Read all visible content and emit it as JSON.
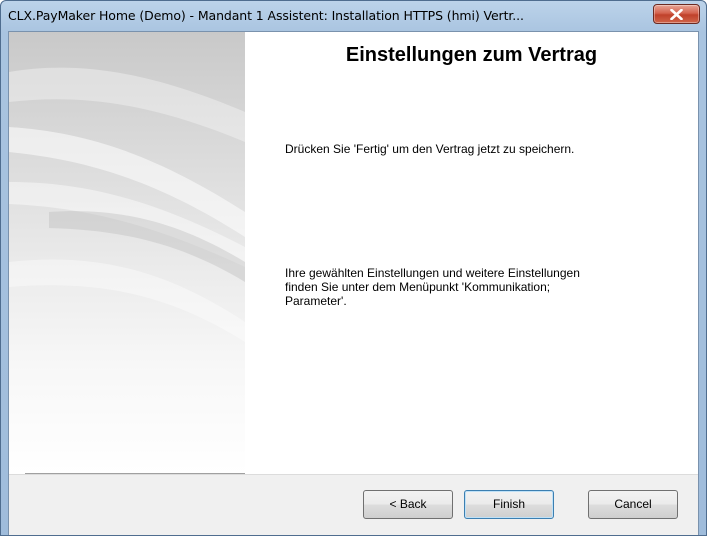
{
  "window": {
    "title": "CLX.PayMaker Home (Demo) - Mandant 1 Assistent: Installation HTTPS (hmi) Vertr..."
  },
  "wizard": {
    "heading": "Einstellungen zum Vertrag",
    "paragraph1": "Drücken Sie 'Fertig' um den Vertrag jetzt zu speichern.",
    "paragraph2": "Ihre gewählten Einstellungen und weitere Einstellungen finden Sie unter dem Menüpunkt 'Kommunikation; Parameter'."
  },
  "buttons": {
    "back": "< Back",
    "finish": "Finish",
    "cancel": "Cancel"
  },
  "icons": {
    "close": "close-icon"
  },
  "colors": {
    "title_bar": "#a9c4e0",
    "close_button": "#c9503a",
    "default_button_border": "#3c7fb1"
  }
}
